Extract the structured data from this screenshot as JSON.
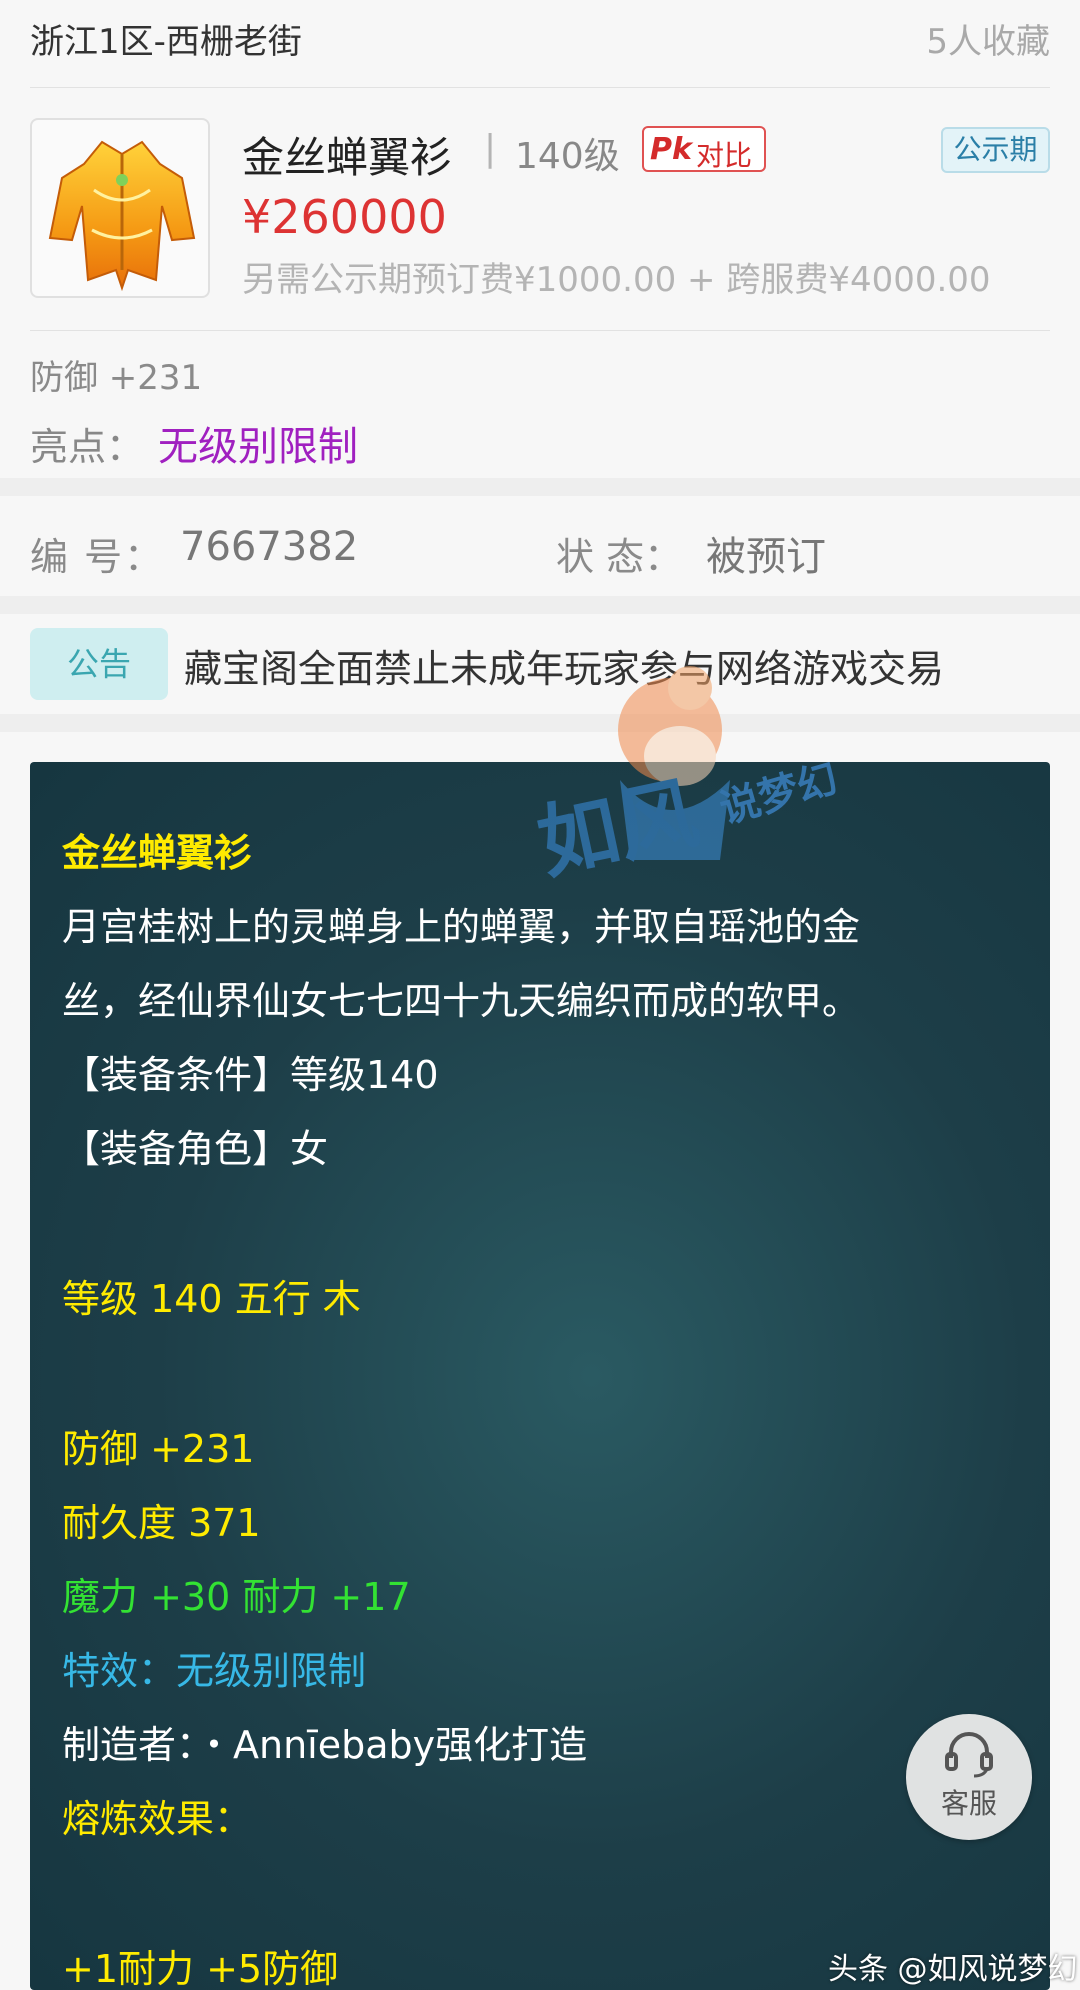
{
  "header": {
    "server": "浙江1区-西栅老街",
    "favorites": "5人收藏"
  },
  "item": {
    "name": "金丝蝉翼衫",
    "separator": "|",
    "level": "140级",
    "pk_icon": "Pk",
    "compare_label": "对比",
    "status_tag": "公示期",
    "price": "¥260000",
    "fees": "另需公示期预订费¥1000.00 + 跨服费¥4000.00",
    "defense": "防御 +231",
    "highlight_label": "亮点：",
    "highlight_value": "无级别限制"
  },
  "info": {
    "id_label": "编 号：",
    "id_value": "7667382",
    "state_label": "状 态：",
    "state_value": "被预订"
  },
  "notice": {
    "badge": "公告",
    "text": "藏宝阁全面禁止未成年玩家参与网络游戏交易"
  },
  "description": {
    "title": "金丝蝉翼衫",
    "line1": "月宫桂树上的灵蝉身上的蝉翼，并取自瑶池的金",
    "line2": "丝，经仙界仙女七七四十九天编织而成的软甲。",
    "line3": "【装备条件】等级140",
    "line4": "【装备角色】女",
    "level_line": "等级 140 五行 木",
    "defense": "防御 +231",
    "durability": "耐久度 371",
    "magic_stats": "魔力 +30 耐力 +17",
    "special": "特效：无级别限制",
    "maker": "制造者：・Annīebaby强化打造",
    "smelt_label": "熔炼效果：",
    "smelt_value": "+1耐力 +5防御"
  },
  "watermark": {
    "text1": "如风",
    "text2": "说梦幻"
  },
  "service": {
    "icon": "headset-icon",
    "label": "客服"
  },
  "footer": {
    "watermark": "头条 @如风说梦幻"
  },
  "colors": {
    "price": "#dd3333",
    "highlight": "#a020c0",
    "panel_bg": "#1d3e48",
    "yellow_text": "#ffeb00",
    "green_text": "#33e233",
    "cyan_text": "#37b8e6"
  }
}
